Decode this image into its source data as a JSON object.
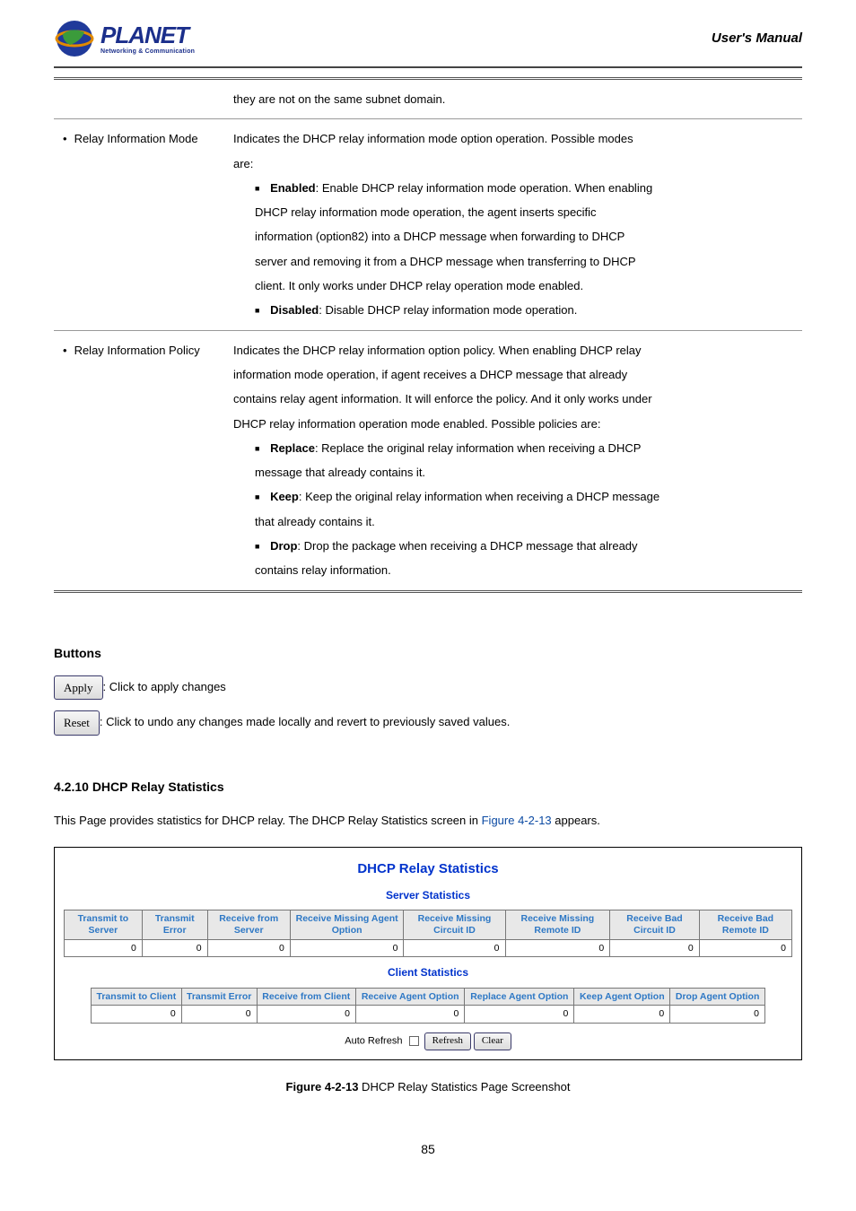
{
  "header": {
    "brand_title": "PLANET",
    "brand_sub": "Networking & Communication",
    "manual_title": "User's Manual"
  },
  "desc_table": {
    "row1": {
      "text": "they are not on the same subnet domain."
    },
    "row2": {
      "label": "Relay Information Mode",
      "intro1": "Indicates the DHCP relay information mode option operation. Possible modes",
      "intro2": "are:",
      "item1_label": "Enabled",
      "item1_text": ": Enable DHCP relay information mode operation. When enabling",
      "item1_line2": "DHCP relay information mode operation, the agent inserts specific",
      "item1_line3": "information (option82) into a DHCP message when forwarding to DHCP",
      "item1_line4": "server and removing it from a DHCP message when transferring to DHCP",
      "item1_line5": "client. It only works under DHCP relay operation mode enabled.",
      "item2_label": "Disabled",
      "item2_text": ": Disable DHCP relay information mode operation."
    },
    "row3": {
      "label": "Relay Information Policy",
      "intro1": "Indicates the DHCP relay information option policy. When enabling DHCP relay",
      "intro2": "information mode operation, if agent receives a DHCP message that already",
      "intro3": "contains relay agent information. It will enforce the policy. And it only works under",
      "intro4": "DHCP relay information operation mode enabled. Possible policies are:",
      "item1_label": "Replace",
      "item1_text": ": Replace the original relay information when receiving a DHCP",
      "item1_line2": "message that already contains it.",
      "item2_label": "Keep",
      "item2_text": ": Keep the original relay information when receiving a DHCP message",
      "item2_line2": "that already contains it.",
      "item3_label": "Drop",
      "item3_text": ": Drop the package when receiving a DHCP message that already",
      "item3_line2": "contains relay information."
    }
  },
  "buttons": {
    "heading": "Buttons",
    "apply_label": "Apply",
    "apply_text": ": Click to apply changes",
    "reset_label": "Reset",
    "reset_text": ": Click to undo any changes made locally and revert to previously saved values."
  },
  "section": {
    "heading": "4.2.10 DHCP Relay Statistics",
    "para_pre": "This Page provides statistics for DHCP relay. The DHCP Relay Statistics screen in ",
    "fig_ref": "Figure 4-2-13",
    "para_post": " appears."
  },
  "stats": {
    "title": "DHCP Relay Statistics",
    "server_sub": "Server Statistics",
    "client_sub": "Client Statistics",
    "server_headers": [
      "Transmit to Server",
      "Transmit Error",
      "Receive from Server",
      "Receive Missing Agent Option",
      "Receive Missing Circuit ID",
      "Receive Missing Remote ID",
      "Receive Bad Circuit ID",
      "Receive Bad Remote ID"
    ],
    "server_values": [
      "0",
      "0",
      "0",
      "0",
      "0",
      "0",
      "0",
      "0"
    ],
    "client_headers": [
      "Transmit to Client",
      "Transmit Error",
      "Receive from Client",
      "Receive Agent Option",
      "Replace Agent Option",
      "Keep Agent Option",
      "Drop Agent Option"
    ],
    "client_values": [
      "0",
      "0",
      "0",
      "0",
      "0",
      "0",
      "0"
    ],
    "auto_refresh": "Auto Refresh",
    "refresh": "Refresh",
    "clear": "Clear"
  },
  "caption_pre": "Figure 4-2-13",
  "caption_post": " DHCP Relay Statistics Page Screenshot",
  "page_number": "85"
}
